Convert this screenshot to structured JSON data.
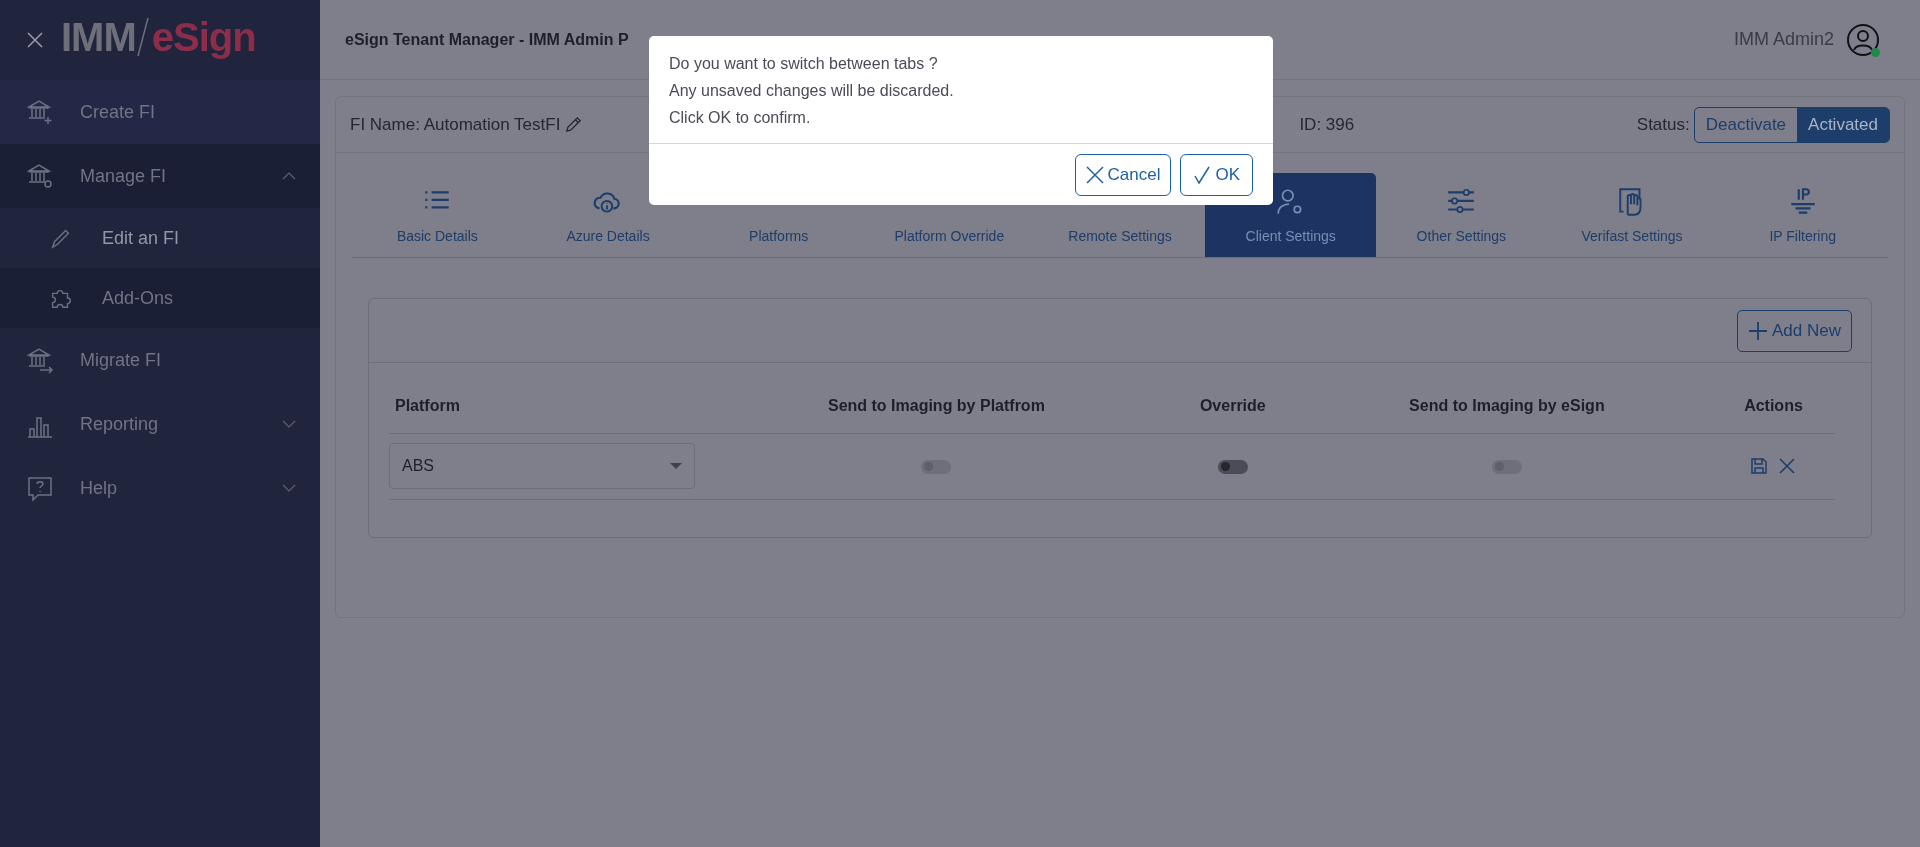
{
  "sidebar": {
    "logo": {
      "left": "IMM",
      "right": "eSign"
    },
    "items": [
      {
        "label": "Create FI"
      },
      {
        "label": "Manage FI",
        "expanded": true,
        "children": [
          {
            "label": "Edit an FI",
            "selected": true
          },
          {
            "label": "Add-Ons",
            "selected": false
          }
        ]
      },
      {
        "label": "Migrate FI"
      },
      {
        "label": "Reporting",
        "expanded": false
      },
      {
        "label": "Help",
        "expanded": false
      }
    ]
  },
  "header": {
    "title": "eSign Tenant Manager - IMM Admin P",
    "user": "IMM Admin2",
    "online": true
  },
  "fi": {
    "name": "FI Name: Automation TestFI",
    "id": "ID: 396",
    "status_label": "Status:",
    "status_options": [
      {
        "label": "Deactivate",
        "selected": false
      },
      {
        "label": "Activated",
        "selected": true
      }
    ]
  },
  "tabs": [
    {
      "label": "Basic Details",
      "selected": false
    },
    {
      "label": "Azure Details",
      "selected": false
    },
    {
      "label": "Platforms",
      "selected": false
    },
    {
      "label": "Platform Override",
      "selected": false
    },
    {
      "label": "Remote Settings",
      "selected": false
    },
    {
      "label": "Client Settings",
      "selected": true
    },
    {
      "label": "Other Settings",
      "selected": false
    },
    {
      "label": "Verifast Settings",
      "selected": false
    },
    {
      "label": "IP Filtering",
      "selected": false
    }
  ],
  "add_button": "Add New",
  "table": {
    "columns": [
      "Platform",
      "Send to Imaging by Platfrom",
      "Override",
      "Send to Imaging by eSign",
      "Actions"
    ],
    "rows": [
      {
        "platform": "ABS",
        "send_platform": {
          "on": false,
          "disabled": true
        },
        "override": {
          "on": false,
          "disabled": false
        },
        "send_esign": {
          "on": false,
          "disabled": true
        }
      }
    ]
  },
  "dialog": {
    "lines": [
      "Do you want to switch between tabs ?",
      "Any unsaved changes will be discarded.",
      "Click OK to confirm."
    ],
    "cancel": "Cancel",
    "ok": "OK"
  }
}
